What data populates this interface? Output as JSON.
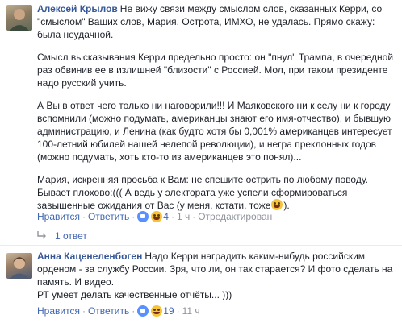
{
  "comments": [
    {
      "author": "Алексей Крылов",
      "paragraphs": [
        "Не вижу связи между смыслом слов, сказанных Керри, со \"смыслом\" Ваших слов, Мария. Острота, ИМХО, не удалась. Прямо скажу: была неудачной.",
        "Смысл высказывания Керри предельно просто: он \"пнул\" Трампа, в очередной раз обвинив ее в излишней \"близости\" с Россией. Мол, при таком президенте надо русский учить.",
        "А Вы в ответ чего только ни наговорили!!! И Маяковского ни к селу ни к городу вспомнили (можно подумать, американцы знают его имя-отчество), и бывшую администрацию, и Ленина (как будто хотя бы 0,001% американцев интересует 100-летний юбилей нашей нелепой революции), и негра преклонных годов (можно подумать, хоть кто-то из американцев это понял)...",
        "Мария, искренняя просьба к Вам: не спешите острить по любому поводу. Бывает плохово:((( А ведь у электората уже успели сформироваться завышенные ожидания от Вас (у меня, кстати, тоже"
      ],
      "last_suffix": ").",
      "actions": {
        "like": "Нравится",
        "reply": "Ответить",
        "likes_count": "4",
        "time": "1 ч",
        "edited": "Отредактирован"
      },
      "replies_label": "1 ответ"
    },
    {
      "author": "Анна Каценеленбоген",
      "paragraphs": [
        "Надо Керри наградить каким-нибудь российским орденом - за службу России. Зря, что ли, он так старается? И фото сделать на память. И видео.",
        "РТ умеет делать качественные отчёты... )))"
      ],
      "actions": {
        "like": "Нравится",
        "reply": "Ответить",
        "likes_count": "19",
        "time": "11 ч"
      }
    }
  ],
  "icons": {
    "like_badge": "like-icon",
    "laugh_emoji": "laughing-emoji-icon",
    "reply_arrow": "reply-arrow-icon"
  },
  "colors": {
    "link": "#4267b2",
    "author": "#365899",
    "meta": "#90949c",
    "like_badge": "#5890ff"
  }
}
